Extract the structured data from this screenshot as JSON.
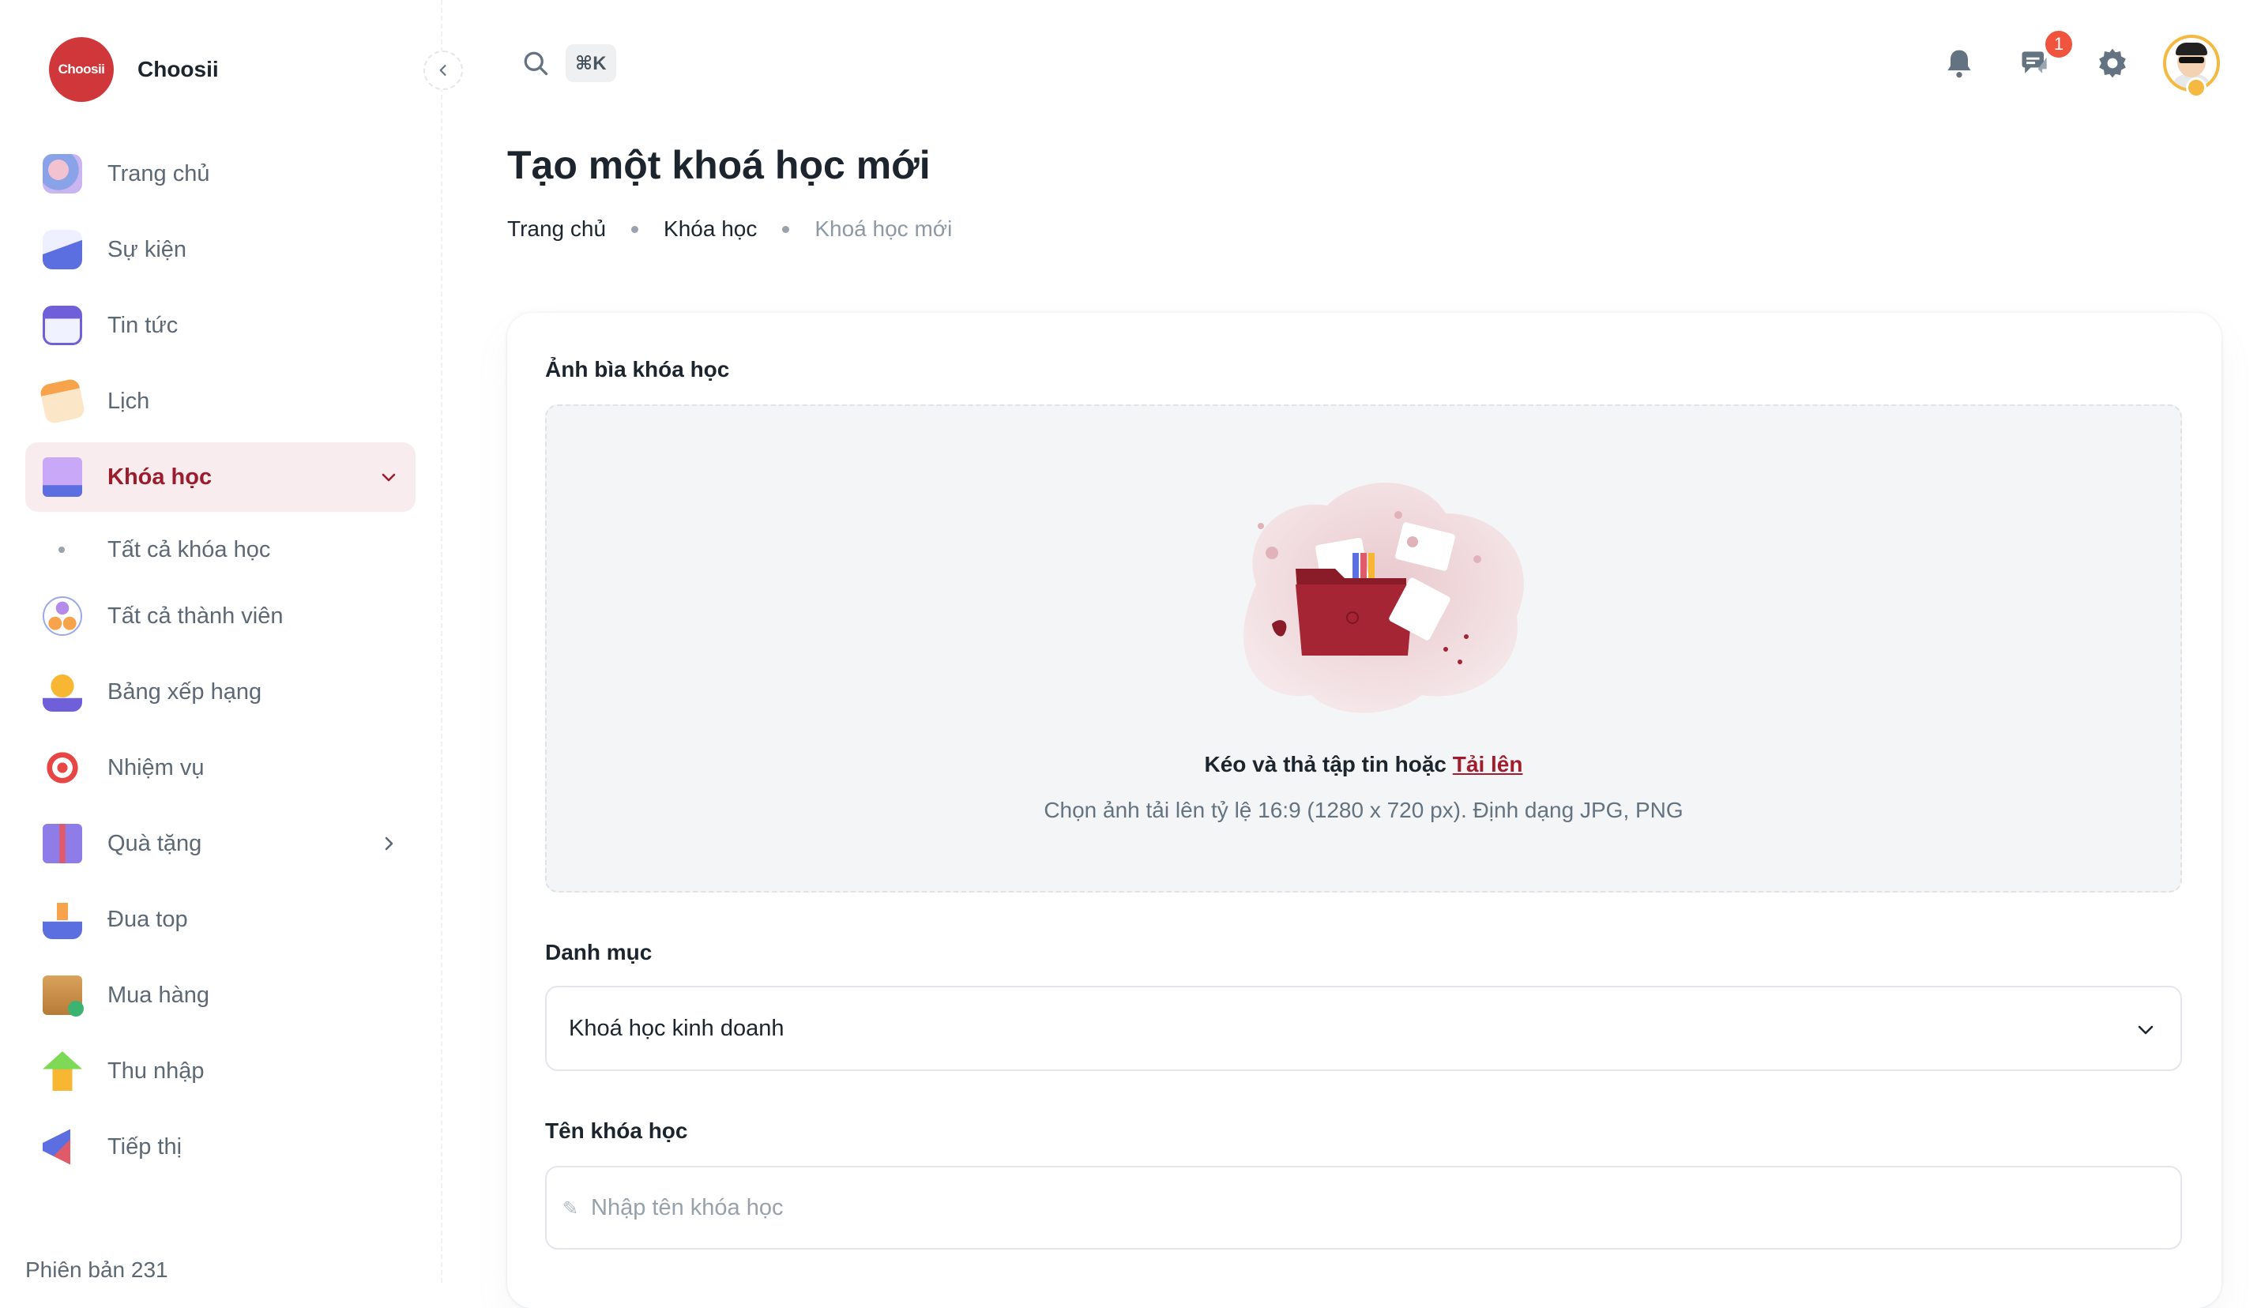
{
  "brand": {
    "logo_text": "Choosii",
    "name": "Choosii"
  },
  "header": {
    "search_shortcut": "⌘K",
    "chat_badge": "1"
  },
  "sidebar": {
    "items": [
      {
        "label": "Trang chủ",
        "icon": "home-icon"
      },
      {
        "label": "Sự kiện",
        "icon": "event-icon"
      },
      {
        "label": "Tin tức",
        "icon": "news-icon"
      },
      {
        "label": "Lịch",
        "icon": "calendar-icon"
      },
      {
        "label": "Khóa học",
        "icon": "course-icon",
        "active": true,
        "expanded": true,
        "children": [
          {
            "label": "Tất cả khóa học"
          }
        ]
      },
      {
        "label": "Tất cả thành viên",
        "icon": "members-icon"
      },
      {
        "label": "Bảng xếp hạng",
        "icon": "trophy-icon"
      },
      {
        "label": "Nhiệm vụ",
        "icon": "target-icon"
      },
      {
        "label": "Quà tặng",
        "icon": "gift-icon",
        "has_children": true
      },
      {
        "label": "Đua top",
        "icon": "podium-icon"
      },
      {
        "label": "Mua hàng",
        "icon": "shopping-icon"
      },
      {
        "label": "Thu nhập",
        "icon": "income-icon"
      },
      {
        "label": "Tiếp thị",
        "icon": "megaphone-icon"
      }
    ],
    "version": "Phiên bản 231"
  },
  "page": {
    "title": "Tạo một khoá học mới",
    "breadcrumb": [
      "Trang chủ",
      "Khóa học",
      "Khoá học mới"
    ]
  },
  "form": {
    "cover_label": "Ảnh bìa khóa học",
    "upload_text": "Kéo và thả tập tin hoặc",
    "upload_link": "Tải lên",
    "upload_hint": "Chọn ảnh tải lên tỷ lệ 16:9 (1280 x 720 px). Định dạng JPG, PNG",
    "category_label": "Danh mục",
    "category_value": "Khoá học kinh doanh",
    "name_label": "Tên khóa học",
    "name_placeholder": "Nhập tên khóa học",
    "name_value": ""
  },
  "colors": {
    "brand": "#d0373a",
    "accent": "#9b1c2c",
    "active_bg": "#f9ecee",
    "badge": "#f0533e"
  }
}
